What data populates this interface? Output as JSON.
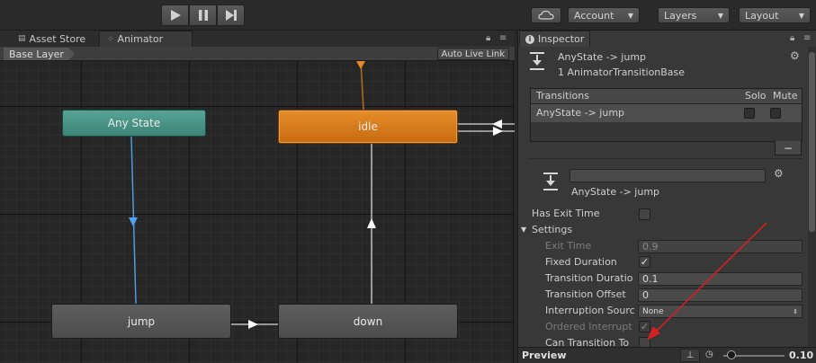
{
  "toolbar": {
    "account_label": "Account",
    "layers_label": "Layers",
    "layout_label": "Layout"
  },
  "left_tabs": [
    {
      "label": "Asset Store"
    },
    {
      "label": "Animator"
    }
  ],
  "graph": {
    "breadcrumb": "Base Layer",
    "auto_live_link": "Auto Live Link",
    "nodes": {
      "any_state": "Any State",
      "idle": "idle",
      "jump": "jump",
      "down": "down"
    }
  },
  "inspector": {
    "tab_label": "Inspector",
    "header_title": "AnyState -> jump",
    "header_subtitle": "1 AnimatorTransitionBase",
    "transitions": {
      "header": "Transitions",
      "solo": "Solo",
      "mute": "Mute",
      "rows": [
        {
          "label": "AnyState -> jump"
        }
      ],
      "remove_label": "−"
    },
    "transition": {
      "name_value": "",
      "label": "AnyState -> jump"
    },
    "has_exit_time": {
      "label": "Has Exit Time",
      "checked": false
    },
    "settings_label": "Settings",
    "exit_time": {
      "label": "Exit Time",
      "value": "0.9"
    },
    "fixed_duration": {
      "label": "Fixed Duration",
      "checked": true
    },
    "transition_duration": {
      "label": "Transition Duratio",
      "value": "0.1"
    },
    "transition_offset": {
      "label": "Transition Offset",
      "value": "0"
    },
    "interruption_source": {
      "label": "Interruption Sourc",
      "value": "None"
    },
    "ordered_interruption": {
      "label": "Ordered Interrupt",
      "checked": true
    },
    "can_transition_to_self": {
      "label": "Can Transition To",
      "checked": false
    },
    "preview_label": "Preview",
    "preview_speed": "0.10"
  },
  "colors": {
    "any_state": "#4a9688",
    "idle": "#d97a1c",
    "annotation_arrow": "#d42020",
    "anystate_wire": "#4ea2ef"
  }
}
